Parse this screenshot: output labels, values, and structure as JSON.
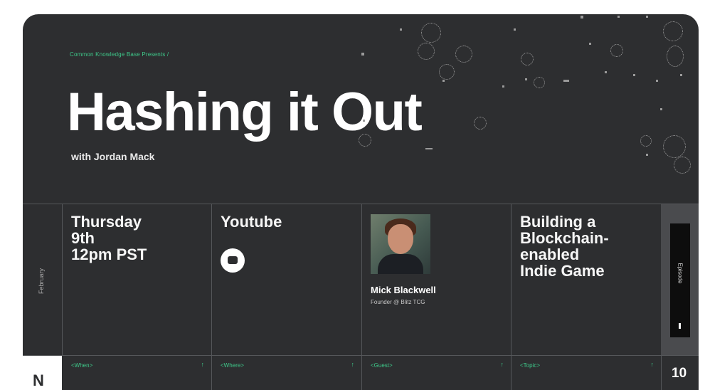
{
  "banner": {
    "kicker": "Common Knowledge Base Presents /",
    "title": "Hashing it Out",
    "subtitle": "with Jordan Mack"
  },
  "schedule": {
    "month": "February",
    "when": "Thursday\n9th\n12pm PST",
    "where": "Youtube",
    "where_icon": "youtube-icon",
    "guest_name": "Mick Blackwell",
    "guest_role": "Founder @ Blitz TCG",
    "topic": "Building a\nBlockchain-\nenabled\nIndie Game",
    "episode_label": "Episode"
  },
  "footer": {
    "logo": "N",
    "tags": [
      {
        "label": "<When>",
        "arrow": "↑"
      },
      {
        "label": "<Where>",
        "arrow": "↑"
      },
      {
        "label": "<Guest>",
        "arrow": "↑"
      },
      {
        "label": "<Topic>",
        "arrow": "↑"
      }
    ],
    "episode_number": "10"
  },
  "colors": {
    "background": "#2d2e30",
    "accent": "#3ec98a",
    "text": "#ffffff"
  }
}
